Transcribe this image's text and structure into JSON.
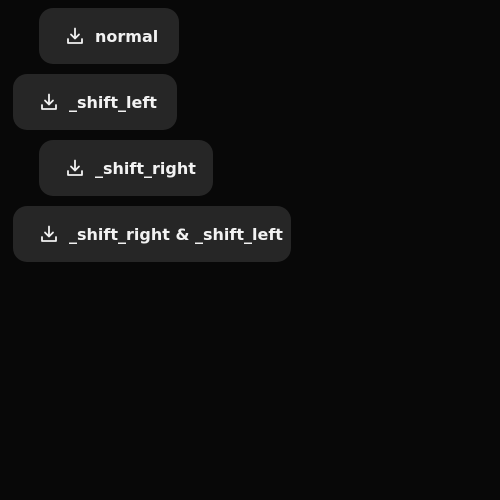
{
  "buttons": [
    {
      "label": "normal",
      "icon": "download-icon"
    },
    {
      "label": "_shift_left",
      "icon": "download-icon"
    },
    {
      "label": "_shift_right",
      "icon": "download-icon"
    },
    {
      "label": "_shift_right & _shift_left",
      "icon": "download-icon"
    }
  ],
  "colors": {
    "background": "#080808",
    "button_bg": "#262626",
    "text": "#f2f2f2"
  }
}
